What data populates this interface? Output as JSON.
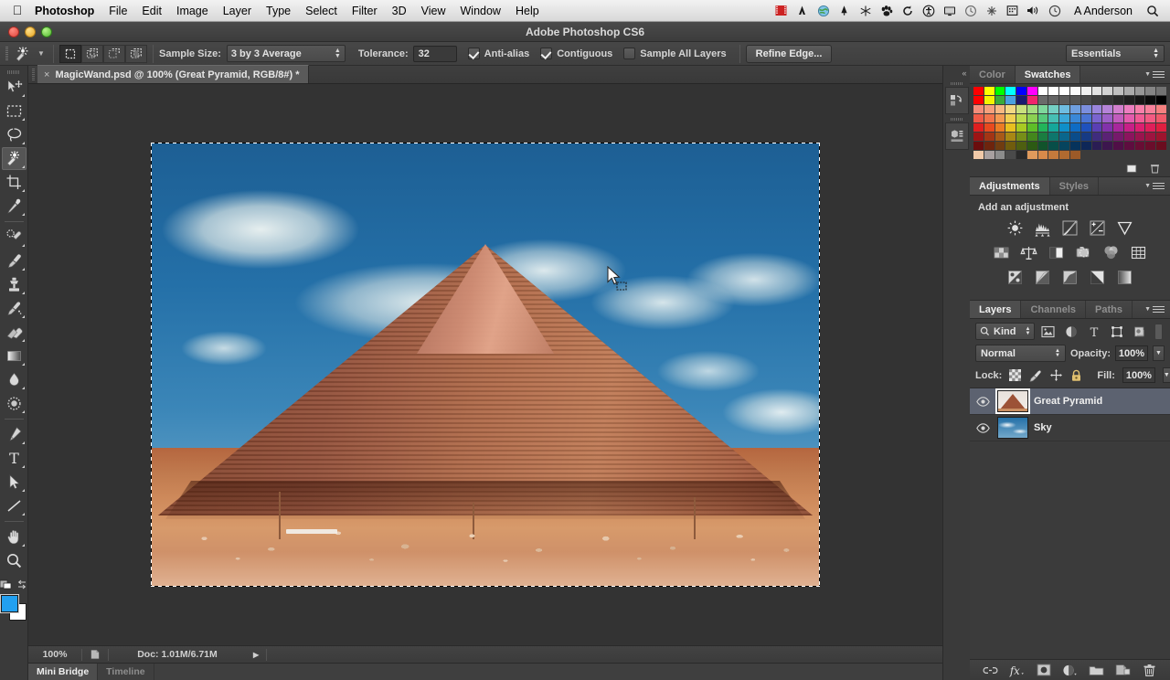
{
  "macmenu": {
    "apple_icon": "apple-logo",
    "items": [
      "Photoshop",
      "File",
      "Edit",
      "Image",
      "Layer",
      "Type",
      "Select",
      "Filter",
      "3D",
      "View",
      "Window",
      "Help"
    ],
    "status_icons": [
      "screenflow-icon",
      "adobe-icon",
      "globe-icon",
      "bell-icon",
      "snowflake-icon",
      "paw-icon",
      "sync-icon",
      "accessibility-icon",
      "display-icon",
      "clock-icon",
      "move-icon",
      "calendar-icon",
      "volume-icon",
      "timemachine-icon"
    ],
    "user": "A Anderson",
    "search_icon": "search-icon"
  },
  "window": {
    "title": "Adobe Photoshop CS6",
    "close": "close-button",
    "minimize": "minimize-button",
    "zoom": "zoom-button"
  },
  "options": {
    "tool_icon": "magic-wand-icon",
    "modes": [
      "new-selection",
      "add-to-selection",
      "subtract-from-selection",
      "intersect-with-selection"
    ],
    "active_mode": 0,
    "sample_size_label": "Sample Size:",
    "sample_size_value": "3 by 3 Average",
    "tolerance_label": "Tolerance:",
    "tolerance_value": "32",
    "antialias_label": "Anti-alias",
    "antialias_checked": true,
    "contiguous_label": "Contiguous",
    "contiguous_checked": true,
    "sample_all_label": "Sample All Layers",
    "sample_all_checked": false,
    "refine_edge_label": "Refine Edge...",
    "workspace": "Essentials"
  },
  "document": {
    "tab_title": "MagicWand.psd @ 100% (Great Pyramid, RGB/8#) *",
    "close_glyph": "×"
  },
  "status": {
    "zoom": "100%",
    "doc_icon": "document-icon",
    "doc_info": "Doc: 1.01M/6.71M",
    "arrow_glyph": "▶",
    "tabs": [
      {
        "label": "Mini Bridge",
        "active": true
      },
      {
        "label": "Timeline",
        "active": false
      }
    ]
  },
  "toolbar": {
    "tools": [
      {
        "name": "move-tool",
        "has_flyout": true,
        "active": false
      },
      {
        "name": "rectangular-marquee-tool",
        "has_flyout": true,
        "active": false
      },
      {
        "name": "lasso-tool",
        "has_flyout": true,
        "active": false
      },
      {
        "name": "magic-wand-tool",
        "has_flyout": true,
        "active": true
      },
      {
        "name": "crop-tool",
        "has_flyout": true,
        "active": false
      },
      {
        "name": "eyedropper-tool",
        "has_flyout": true,
        "active": false
      },
      {
        "name": "spot-healing-brush-tool",
        "has_flyout": true,
        "active": false
      },
      {
        "name": "brush-tool",
        "has_flyout": true,
        "active": false
      },
      {
        "name": "clone-stamp-tool",
        "has_flyout": true,
        "active": false
      },
      {
        "name": "history-brush-tool",
        "has_flyout": true,
        "active": false
      },
      {
        "name": "eraser-tool",
        "has_flyout": true,
        "active": false
      },
      {
        "name": "gradient-tool",
        "has_flyout": true,
        "active": false
      },
      {
        "name": "blur-tool",
        "has_flyout": true,
        "active": false
      },
      {
        "name": "dodge-tool",
        "has_flyout": true,
        "active": false
      },
      {
        "name": "pen-tool",
        "has_flyout": true,
        "active": false
      },
      {
        "name": "type-tool",
        "has_flyout": true,
        "active": false
      },
      {
        "name": "path-selection-tool",
        "has_flyout": true,
        "active": false
      },
      {
        "name": "line-tool",
        "has_flyout": true,
        "active": false
      },
      {
        "name": "hand-tool",
        "has_flyout": true,
        "active": false
      },
      {
        "name": "zoom-tool",
        "has_flyout": false,
        "active": false
      }
    ],
    "foreground_color": "#22a0f0",
    "background_color": "#ffffff"
  },
  "rail": {
    "collapse_glyph": "«",
    "buttons": [
      "mini-bridge-icon",
      "history-icon"
    ]
  },
  "color_panel": {
    "tabs": [
      {
        "label": "Color",
        "active": false
      },
      {
        "label": "Swatches",
        "active": true
      }
    ],
    "swatch_rows": [
      [
        "#ff0000",
        "#ffff00",
        "#00ff00",
        "#00ffff",
        "#0000ff",
        "#ff00ff",
        "#ffffff",
        "#ffffff",
        "#ffffff",
        "#fafafa",
        "#f0f0f0",
        "#e2e2e2",
        "#d2d2d2",
        "#c0c0c0",
        "#ababab",
        "#989898",
        "#858585",
        "#727272"
      ],
      [
        "#ff0000",
        "#f4f400",
        "#3aab3a",
        "#4aa0e0",
        "#1a1a70",
        "#f0246c",
        "#6a6a6a",
        "#646464",
        "#5c5c5c",
        "#545454",
        "#4a4a4a",
        "#3e3e3e",
        "#343434",
        "#2a2a2a",
        "#202020",
        "#161616",
        "#0c0c0c",
        "#000000"
      ],
      [
        "#f48d7a",
        "#f6a07c",
        "#f7b882",
        "#f2d884",
        "#c9e07e",
        "#a3dc7e",
        "#7ed79c",
        "#74cfc4",
        "#6fbde2",
        "#6f9fe0",
        "#7b8ede",
        "#9a85dd",
        "#b583d8",
        "#d37fce",
        "#ec7ec0",
        "#f77faa",
        "#f7809a",
        "#f5807f"
      ],
      [
        "#f05a47",
        "#f2744b",
        "#f49a52",
        "#f0cf52",
        "#bada4f",
        "#8bd152",
        "#55c87a",
        "#46bfb4",
        "#3aa8da",
        "#3a88d8",
        "#4a74d4",
        "#7a64d0",
        "#9d60c8",
        "#c25cbd",
        "#e45bad",
        "#f25b95",
        "#f35b82",
        "#f15a6a"
      ],
      [
        "#e01f1f",
        "#e84a1e",
        "#eb7c24",
        "#e8c01f",
        "#a8ca22",
        "#5ebe28",
        "#22b45a",
        "#15a79a",
        "#0f8fc8",
        "#0f6cc4",
        "#1f51bd",
        "#5a3fb4",
        "#8232ab",
        "#a8279c",
        "#c81f87",
        "#dc1f70",
        "#e01f5a",
        "#e01f40"
      ],
      [
        "#9e1414",
        "#a33514",
        "#a85a18",
        "#a88814",
        "#768e18",
        "#43861c",
        "#1a7d40",
        "#0e766c",
        "#0a668c",
        "#0a4c8a",
        "#163a84",
        "#3f2c7e",
        "#5a2275",
        "#76196b",
        "#8c145e",
        "#9a144e",
        "#9e1440",
        "#9e142e"
      ],
      [
        "#6a0d0d",
        "#6e240d",
        "#703c10",
        "#705c0d",
        "#4e5f10",
        "#2c5a13",
        "#11532b",
        "#084e48",
        "#06445e",
        "#06335c",
        "#0e2758",
        "#2a1d54",
        "#3c164e",
        "#500f47",
        "#5e0d3f",
        "#680d34",
        "#6a0d2b",
        "#6a0d1f"
      ],
      [
        "#f0c9a8",
        "#a8a0a0",
        "#8c8c8c",
        "#4a4a4a",
        "#2a2a2a",
        "#e09a5c",
        "#d88a4a",
        "#c47a3c",
        "#b06a30",
        "#9c5a28",
        "#3b3b3b",
        "#3b3b3b",
        "#3b3b3b",
        "#3b3b3b",
        "#3b3b3b",
        "#3b3b3b",
        "#3b3b3b",
        "#3b3b3b"
      ]
    ],
    "footer_icons": [
      "new-swatch-icon",
      "delete-swatch-icon"
    ]
  },
  "adjustments_panel": {
    "tabs": [
      {
        "label": "Adjustments",
        "active": true
      },
      {
        "label": "Styles",
        "active": false
      }
    ],
    "heading": "Add an adjustment",
    "rows": [
      [
        "brightness-contrast-icon",
        "levels-icon",
        "curves-icon",
        "exposure-icon",
        "vibrance-icon"
      ],
      [
        "hue-saturation-icon",
        "color-balance-icon",
        "black-white-icon",
        "photo-filter-icon",
        "channel-mixer-icon",
        "color-lookup-icon"
      ],
      [
        "invert-icon",
        "posterize-icon",
        "threshold-icon",
        "gradient-map-icon",
        "selective-color-icon"
      ]
    ]
  },
  "layers_panel": {
    "tabs": [
      {
        "label": "Layers",
        "active": true
      },
      {
        "label": "Channels",
        "active": false
      },
      {
        "label": "Paths",
        "active": false
      }
    ],
    "filter_label": "Kind",
    "filter_icon": "search-icon",
    "filter_type_icons": [
      "pixel-filter-icon",
      "adjustment-filter-icon",
      "type-filter-icon",
      "shape-filter-icon",
      "smartobject-filter-icon"
    ],
    "filter_toggle": "filter-power-icon",
    "blend_mode": "Normal",
    "opacity_label": "Opacity:",
    "opacity_value": "100%",
    "lock_label": "Lock:",
    "lock_icons": [
      "lock-transparent-pixels-icon",
      "lock-image-pixels-icon",
      "lock-position-icon",
      "lock-all-icon"
    ],
    "fill_label": "Fill:",
    "fill_value": "100%",
    "layers": [
      {
        "name": "Great Pyramid",
        "visible": true,
        "selected": true,
        "thumb": "pyramid-thumb"
      },
      {
        "name": "Sky",
        "visible": true,
        "selected": false,
        "thumb": "sky-thumb"
      }
    ],
    "footer_icons": [
      "link-layers-icon",
      "layer-style-icon",
      "layer-mask-icon",
      "new-adjustment-layer-icon",
      "new-group-icon",
      "new-layer-icon",
      "delete-layer-icon"
    ]
  },
  "canvas": {
    "selection_active": true,
    "cursor": "arrow-with-marquee-cursor",
    "image_alt": "Great Pyramid of Giza against blue cloudy sky"
  },
  "colors": {
    "app_bg": "#3b3b3b",
    "panel_bg": "#3b3b3b",
    "canvas_bg": "#333333",
    "selected_layer": "#5c6270",
    "accent_blue": "#22a0f0"
  }
}
